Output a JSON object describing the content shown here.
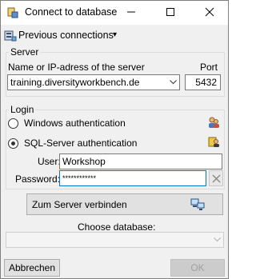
{
  "window": {
    "title": "Connect to database"
  },
  "toolbar": {
    "previous_connections": "Previous connections",
    "dropdown_arrow": "▾"
  },
  "server": {
    "group_label": "Server",
    "name_label": "Name or IP-adress of the server",
    "port_label": "Port",
    "name_value": "training.diversityworkbench.de",
    "port_value": "5432"
  },
  "login": {
    "group_label": "Login",
    "windows_auth_label": "Windows authentication",
    "sql_auth_label": "SQL-Server authentication",
    "selected": "sql",
    "user_label": "User:",
    "user_value": "Workshop",
    "password_label": "Password:",
    "password_value": "************"
  },
  "connect_button": {
    "label": "Zum Server verbinden"
  },
  "database": {
    "label": "Choose database:",
    "selected": ""
  },
  "footer": {
    "cancel_label": "Abbrechen",
    "ok_label": "OK"
  },
  "icons": {
    "app": "database-connect-icon",
    "previous_connections": "server-list-icon",
    "windows_auth": "users-icon",
    "sql_auth": "lock-user-icon",
    "connect": "network-computer-icon",
    "clear": "close-icon"
  },
  "colors": {
    "focus_border": "#0078d7",
    "ok_disabled_text": "#a0a0a0"
  }
}
